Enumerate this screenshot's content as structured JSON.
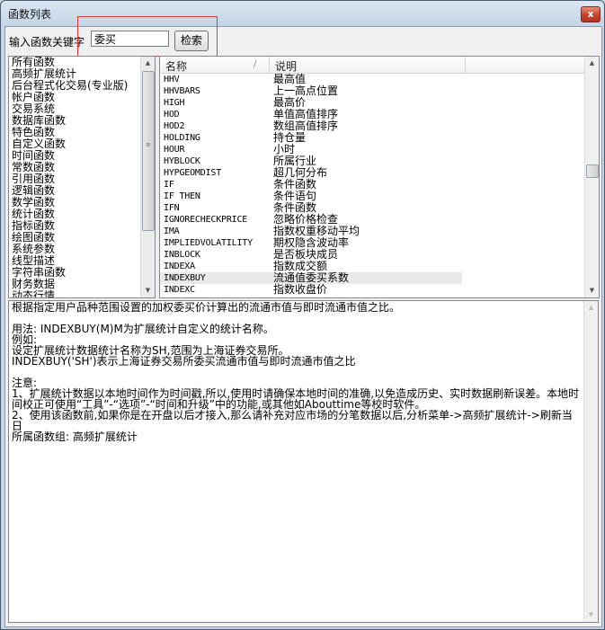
{
  "window": {
    "title": "函数列表",
    "close_glyph": "x"
  },
  "search": {
    "label": "输入函数关键字",
    "value": "委买",
    "button": "检索"
  },
  "categories": [
    "所有函数",
    "高频扩展统计",
    "后台程式化交易(专业版)",
    "帐户函数",
    "交易系统",
    "数据库函数",
    "特色函数",
    "自定义函数",
    "时间函数",
    "常数函数",
    "引用函数",
    "逻辑函数",
    "数学函数",
    "统计函数",
    "指标函数",
    "绘图函数",
    "系统参数",
    "线型描述",
    "字符串函数",
    "财务数据",
    "动态行情"
  ],
  "table": {
    "headers": {
      "name": "名称",
      "desc": "说明"
    },
    "rows": [
      {
        "name": "HHV",
        "desc": "最高值"
      },
      {
        "name": "HHVBARS",
        "desc": "上一高点位置"
      },
      {
        "name": "HIGH",
        "desc": "最高价"
      },
      {
        "name": "HOD",
        "desc": "单值高值排序"
      },
      {
        "name": "HOD2",
        "desc": "数组高值排序"
      },
      {
        "name": "HOLDING",
        "desc": "持仓量"
      },
      {
        "name": "HOUR",
        "desc": "小时"
      },
      {
        "name": "HYBLOCK",
        "desc": "所属行业"
      },
      {
        "name": "HYPGEOMDIST",
        "desc": "超几何分布"
      },
      {
        "name": "IF",
        "desc": "条件函数"
      },
      {
        "name": "IF THEN",
        "desc": "条件语句"
      },
      {
        "name": "IFN",
        "desc": "条件函数"
      },
      {
        "name": "IGNORECHECKPRICE",
        "desc": "忽略价格检查"
      },
      {
        "name": "IMA",
        "desc": "指数权重移动平均"
      },
      {
        "name": "IMPLIEDVOLATILITY",
        "desc": "期权隐含波动率"
      },
      {
        "name": "INBLOCK",
        "desc": "是否板块成员"
      },
      {
        "name": "INDEXA",
        "desc": "指数成交额"
      },
      {
        "name": "INDEXBUY",
        "desc": "流通值委买系数"
      },
      {
        "name": "INDEXC",
        "desc": "指数收盘价"
      }
    ]
  },
  "description": [
    "根据指定用户品种范围设置的加权委买价计算出的流通市值与即时流通市值之比。",
    "",
    "用法: INDEXBUY(M)M为扩展统计自定义的统计名称。",
    "例如:",
    "设定扩展统计数据统计名称为SH,范围为上海证券交易所。",
    "INDEXBUY('SH')表示上海证券交易所委买流通市值与即时流通市值之比",
    "",
    "注意:",
    "1、扩展统计数据以本地时间作为时间戳,所以,使用时请确保本地时间的准确,以免造成历史、实时数据刷新误差。本地时间校正可使用“工具”-“选项”-“时间和升级”中的功能,或其他如Abouttime等校时软件。",
    "2、使用该函数前,如果你是在开盘以后才接入,那么请补充对应市场的分笔数据以后,分析菜单->高频扩展统计->刷新当日",
    "所属函数组: 高频扩展统计"
  ]
}
